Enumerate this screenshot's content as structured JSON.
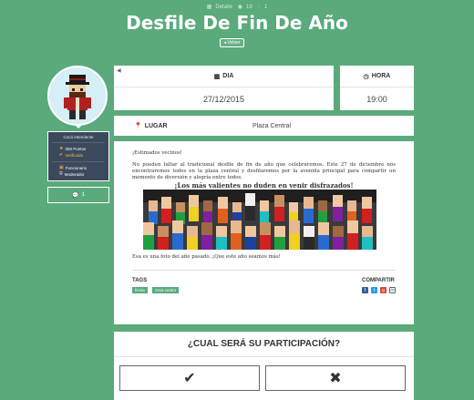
{
  "meta": {
    "date_icon": "calendar-icon",
    "date": "Detalle",
    "views_icon": "eye-icon",
    "views": "19",
    "comments_icon": "comment-icon",
    "comments": "1"
  },
  "event": {
    "title": "Desfile De Fin De Año",
    "back_label": "◂ Volver"
  },
  "user": {
    "name": "Cocú Intendente",
    "points": "250 Puntos",
    "verified": "Verificado",
    "role1": "Funcionario",
    "role2": "Moderador",
    "comments_count": "1"
  },
  "details": {
    "dia_label": "DIA",
    "dia_value": "27/12/2015",
    "hora_label": "HORA",
    "hora_value": "19:00",
    "lugar_label": "LUGAR",
    "lugar_value": "Plaza Central"
  },
  "content": {
    "greeting": "¡Estimados vecinos!",
    "body": "No pueden faltar al tradicional desfile de fin de año que celebraremos. Este 27 de diciembre nos encontraremos todos en la plaza central y desfilaremos por la avenida principal para compartir un momento de diversión y alegría entre todos.",
    "highlight": "¡Los más valientes no duden en venir disfrazados!",
    "footer": "Esa es una foto del año pasado. ¡Que este año seamos más!"
  },
  "tags": {
    "label": "TAGS",
    "items": [
      "fiesta",
      "zona centro"
    ]
  },
  "share": {
    "label": "COMPARTIR",
    "colors": {
      "facebook": "#3b5998",
      "twitter": "#1da1f2",
      "google": "#db4437",
      "email": "#666666"
    }
  },
  "participation": {
    "question": "¿CUAL SERÁ SU PARTICIPACIÓN?",
    "yes_icon": "check-icon",
    "no_icon": "x-icon"
  },
  "colors": {
    "background": "#5aaa7c",
    "user_card": "#3a4a5c",
    "tag": "#5aaa7c"
  }
}
